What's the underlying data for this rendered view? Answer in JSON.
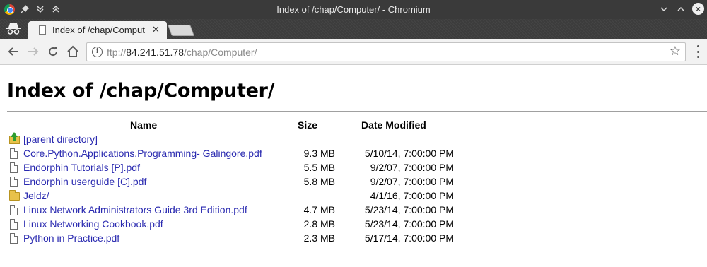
{
  "window": {
    "title": "Index of /chap/Computer/ - Chromium",
    "close_glyph": "×"
  },
  "tab": {
    "title": "Index of /chap/Comput",
    "close_glyph": "✕"
  },
  "omnibox": {
    "scheme": "ftp://",
    "host": "84.241.51.78",
    "path": "/chap/Computer/"
  },
  "page": {
    "heading": "Index of /chap/Computer/",
    "columns": {
      "name": "Name",
      "size": "Size",
      "date": "Date Modified"
    },
    "entries": [
      {
        "type": "parent",
        "icon": "up-folder-icon",
        "name": "[parent directory]",
        "size": "",
        "date": ""
      },
      {
        "type": "file",
        "icon": "file-icon",
        "name": "Core.Python.Applications.Programming- Galingore.pdf",
        "size": "9.3 MB",
        "date": "5/10/14, 7:00:00 PM"
      },
      {
        "type": "file",
        "icon": "file-icon",
        "name": "Endorphin Tutorials [P].pdf",
        "size": "5.5 MB",
        "date": "9/2/07, 7:00:00 PM"
      },
      {
        "type": "file",
        "icon": "file-icon",
        "name": "Endorphin userguide [C].pdf",
        "size": "5.8 MB",
        "date": "9/2/07, 7:00:00 PM"
      },
      {
        "type": "folder",
        "icon": "folder-icon",
        "name": "Jeldz/",
        "size": "",
        "date": "4/1/16, 7:00:00 PM"
      },
      {
        "type": "file",
        "icon": "file-icon",
        "name": "Linux Network Administrators Guide 3rd Edition.pdf",
        "size": "4.7 MB",
        "date": "5/23/14, 7:00:00 PM"
      },
      {
        "type": "file",
        "icon": "file-icon",
        "name": "Linux Networking Cookbook.pdf",
        "size": "2.8 MB",
        "date": "5/23/14, 7:00:00 PM"
      },
      {
        "type": "file",
        "icon": "file-icon",
        "name": "Python in Practice.pdf",
        "size": "2.3 MB",
        "date": "5/17/14, 7:00:00 PM"
      }
    ]
  },
  "colors": {
    "link": "#2a2ab0",
    "titlebar": "#3a3a3a",
    "toolbar": "#f2f2f2"
  }
}
